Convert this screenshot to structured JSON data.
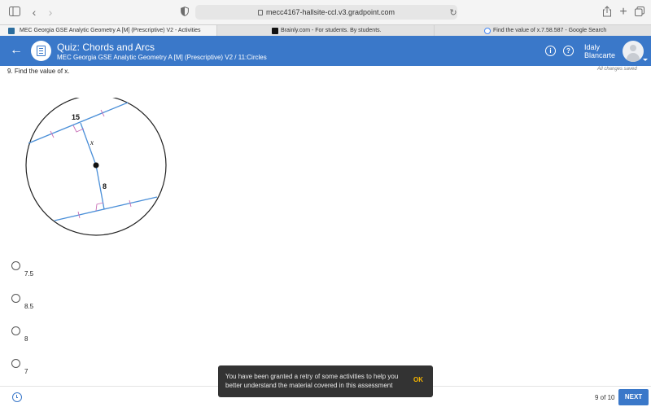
{
  "browser": {
    "url": "mecc4167-hallsite-ccl.v3.gradpoint.com"
  },
  "tabs": [
    {
      "label": "MEC Georgia GSE Analytic Geometry A [M] (Prescriptive) V2 - Activities",
      "active": true
    },
    {
      "label": "Brainly.com - For students. By students.",
      "active": false
    },
    {
      "label": "Find the value of x.7.58.587 - Google Search",
      "active": false
    }
  ],
  "header": {
    "title": "Quiz: Chords and Arcs",
    "subtitle": "MEC Georgia GSE Analytic Geometry A [M] (Prescriptive) V2 / 11:Circles",
    "info_glyph": "i",
    "help_glyph": "?",
    "user_first": "Idaly",
    "user_last": "Blancarte"
  },
  "question": {
    "text": "9. Find the value of x.",
    "save_status": "All changes saved"
  },
  "figure": {
    "label_top": "15",
    "label_x": "x",
    "label_bottom": "8",
    "line_color": "#4a8fd8",
    "tick_color": "#c86fb6"
  },
  "options": [
    {
      "label": "7.5"
    },
    {
      "label": "8.5"
    },
    {
      "label": "8"
    },
    {
      "label": "7"
    }
  ],
  "toast": {
    "message": "You have been granted a retry of some activities to help you better understand the material covered in this assessment",
    "ok_label": "OK"
  },
  "footer": {
    "page_count": "9 of 10",
    "next_label": "NEXT"
  },
  "colors": {
    "header_blue": "#3a78c9",
    "toast_bg": "#333333",
    "ok_color": "#f4b400"
  }
}
